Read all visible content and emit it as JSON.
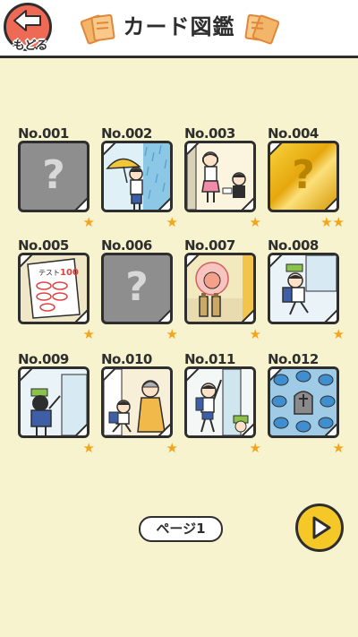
{
  "header": {
    "back_label": "もどる",
    "title": "カード図鑑"
  },
  "cards": [
    {
      "number": "No.001",
      "state": "locked",
      "symbol": "?",
      "stars": 1
    },
    {
      "number": "No.002",
      "state": "art",
      "art": "boy-umbrella-rain",
      "stars": 1
    },
    {
      "number": "No.003",
      "state": "art",
      "art": "girl-and-boy-door",
      "stars": 1
    },
    {
      "number": "No.004",
      "state": "gold",
      "symbol": "?",
      "stars": 2
    },
    {
      "number": "No.005",
      "state": "art",
      "art": "test-paper-100",
      "paper_text": "テスト",
      "paper_score": "100",
      "stars": 1
    },
    {
      "number": "No.006",
      "state": "locked",
      "symbol": "?",
      "stars": 1
    },
    {
      "number": "No.007",
      "state": "art",
      "art": "peach-bottles",
      "stars": 1
    },
    {
      "number": "No.008",
      "state": "art",
      "art": "boy-running",
      "stars": 1
    },
    {
      "number": "No.009",
      "state": "art",
      "art": "boy-knocking",
      "stars": 1
    },
    {
      "number": "No.010",
      "state": "art",
      "art": "boy-and-grandma",
      "stars": 1
    },
    {
      "number": "No.011",
      "state": "art",
      "art": "boy-waving",
      "stars": 1
    },
    {
      "number": "No.012",
      "state": "art",
      "art": "grave-blue-slimes",
      "stars": 1
    }
  ],
  "pager": {
    "page_label": "ページ1"
  },
  "colors": {
    "background": "#f8f3cf",
    "star": "#f3a51c",
    "back_button": "#ee6a55",
    "next_button": "#f6c827"
  }
}
